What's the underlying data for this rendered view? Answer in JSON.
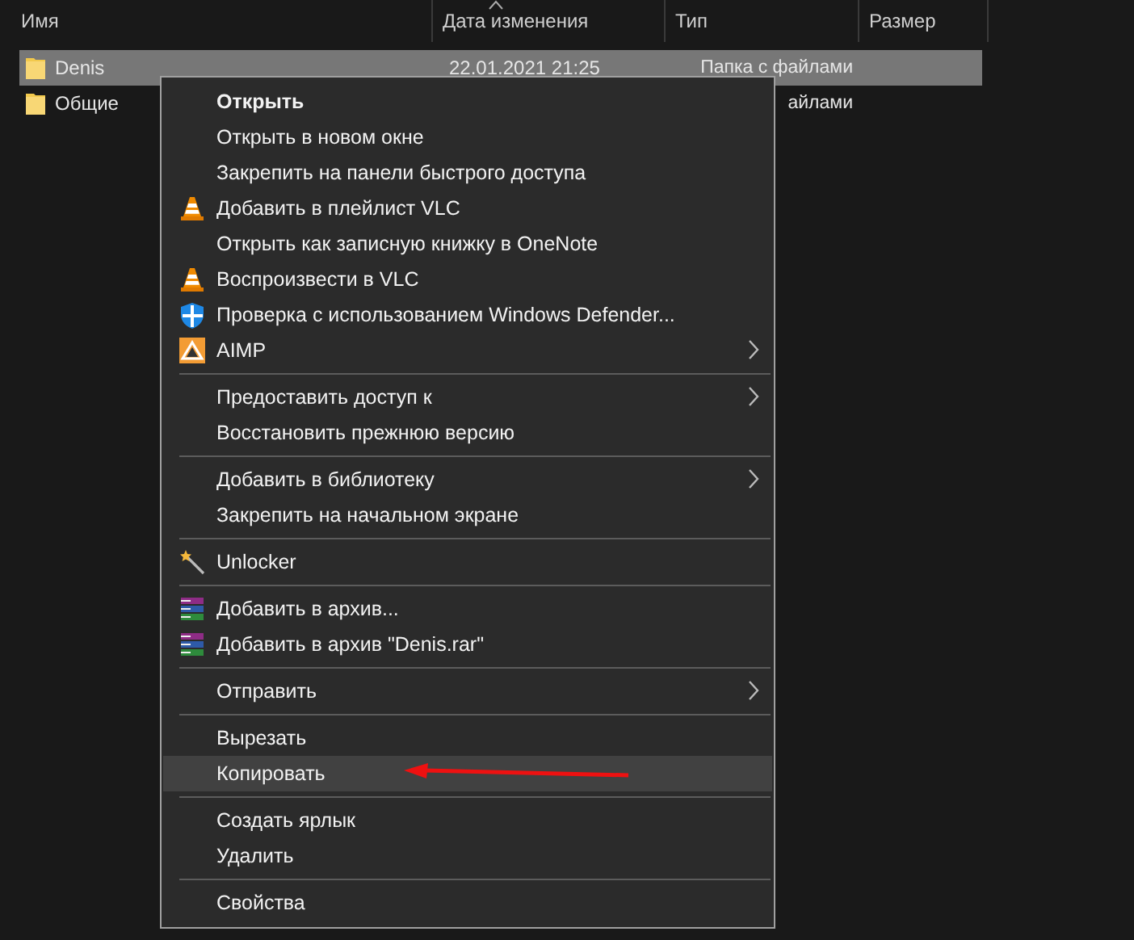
{
  "columns": [
    "Имя",
    "Дата изменения",
    "Тип",
    "Размер"
  ],
  "files": [
    {
      "name": "Denis",
      "date": "22.01.2021 21:25",
      "type": "Папка с файлами",
      "selected": true
    },
    {
      "name": "Общие",
      "type": "айлами",
      "selected": false
    }
  ],
  "context_menu": [
    {
      "kind": "item",
      "label": "Открыть",
      "default": true,
      "selected": false
    },
    {
      "kind": "item",
      "label": "Открыть в новом окне",
      "selected": false
    },
    {
      "kind": "item",
      "label": "Закрепить на панели быстрого доступа",
      "selected": false
    },
    {
      "kind": "item",
      "label": "Добавить в плейлист VLC",
      "selected": false
    },
    {
      "kind": "item",
      "label": "Открыть как записную книжку в OneNote",
      "selected": false
    },
    {
      "kind": "item",
      "label": "Воспроизвести в VLC",
      "selected": false
    },
    {
      "kind": "item",
      "label": "Проверка с использованием Windows Defender...",
      "selected": false
    },
    {
      "kind": "item",
      "label": "AIMP",
      "submenu": true,
      "selected": false
    },
    {
      "kind": "separator"
    },
    {
      "kind": "item",
      "label": "Предоставить доступ к",
      "submenu": true,
      "selected": false
    },
    {
      "kind": "item",
      "label": "Восстановить прежнюю версию",
      "selected": false
    },
    {
      "kind": "separator"
    },
    {
      "kind": "item",
      "label": "Добавить в библиотеку",
      "submenu": true,
      "selected": false
    },
    {
      "kind": "item",
      "label": "Закрепить на начальном экране",
      "selected": false
    },
    {
      "kind": "separator"
    },
    {
      "kind": "item",
      "label": "Unlocker",
      "selected": false
    },
    {
      "kind": "separator"
    },
    {
      "kind": "item",
      "label": "Добавить в архив...",
      "selected": false
    },
    {
      "kind": "item",
      "label": "Добавить в архив \"Denis.rar\"",
      "selected": false
    },
    {
      "kind": "separator"
    },
    {
      "kind": "item",
      "label": "Отправить",
      "submenu": true,
      "selected": false
    },
    {
      "kind": "separator"
    },
    {
      "kind": "item",
      "label": "Вырезать",
      "selected": false
    },
    {
      "kind": "item",
      "label": "Копировать",
      "selected": true,
      "annotated": true
    },
    {
      "kind": "separator"
    },
    {
      "kind": "item",
      "label": "Создать ярлык",
      "selected": false
    },
    {
      "kind": "item",
      "label": "Удалить",
      "selected": false
    },
    {
      "kind": "separator"
    },
    {
      "kind": "item",
      "label": "Свойства",
      "selected": false
    }
  ]
}
